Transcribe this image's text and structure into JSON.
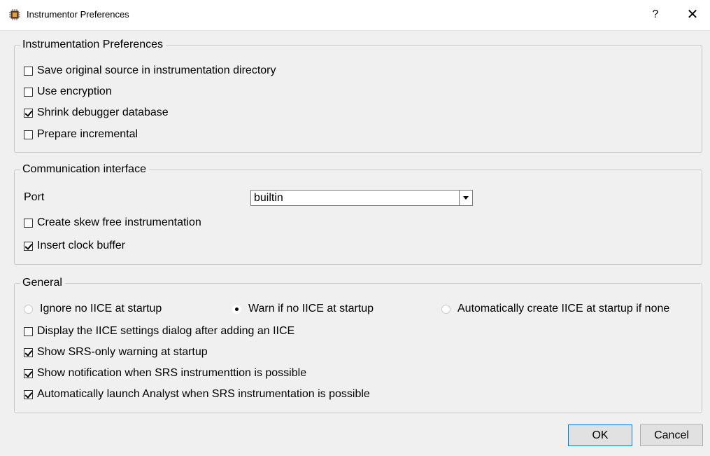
{
  "window": {
    "title": "Instrumentor Preferences",
    "help_label": "?",
    "close_label": "✕"
  },
  "instrumentation": {
    "legend": "Instrumentation Preferences",
    "options": [
      {
        "label": "Save original source in instrumentation directory",
        "checked": false
      },
      {
        "label": "Use encryption",
        "checked": false
      },
      {
        "label": "Shrink debugger database",
        "checked": true
      },
      {
        "label": "Prepare incremental",
        "checked": false
      }
    ]
  },
  "communication": {
    "legend": "Communication interface",
    "port_label": "Port",
    "port_value": "builtin",
    "options": [
      {
        "label": "Create skew free instrumentation",
        "checked": false
      },
      {
        "label": "Insert clock buffer",
        "checked": true
      }
    ]
  },
  "general": {
    "legend": "General",
    "radios": [
      {
        "label": "Ignore no IICE at startup",
        "selected": false
      },
      {
        "label": "Warn if no IICE at startup",
        "selected": true
      },
      {
        "label": "Automatically create IICE at startup if none",
        "selected": false
      }
    ],
    "options": [
      {
        "label": "Display the IICE settings dialog after adding an IICE",
        "checked": false
      },
      {
        "label": "Show SRS-only warning at startup",
        "checked": true
      },
      {
        "label": "Show notification when SRS instrumenttion is possible",
        "checked": true
      },
      {
        "label": "Automatically launch Analyst when SRS instrumentation is possible",
        "checked": true
      }
    ]
  },
  "buttons": {
    "ok_label": "OK",
    "cancel_label": "Cancel"
  }
}
